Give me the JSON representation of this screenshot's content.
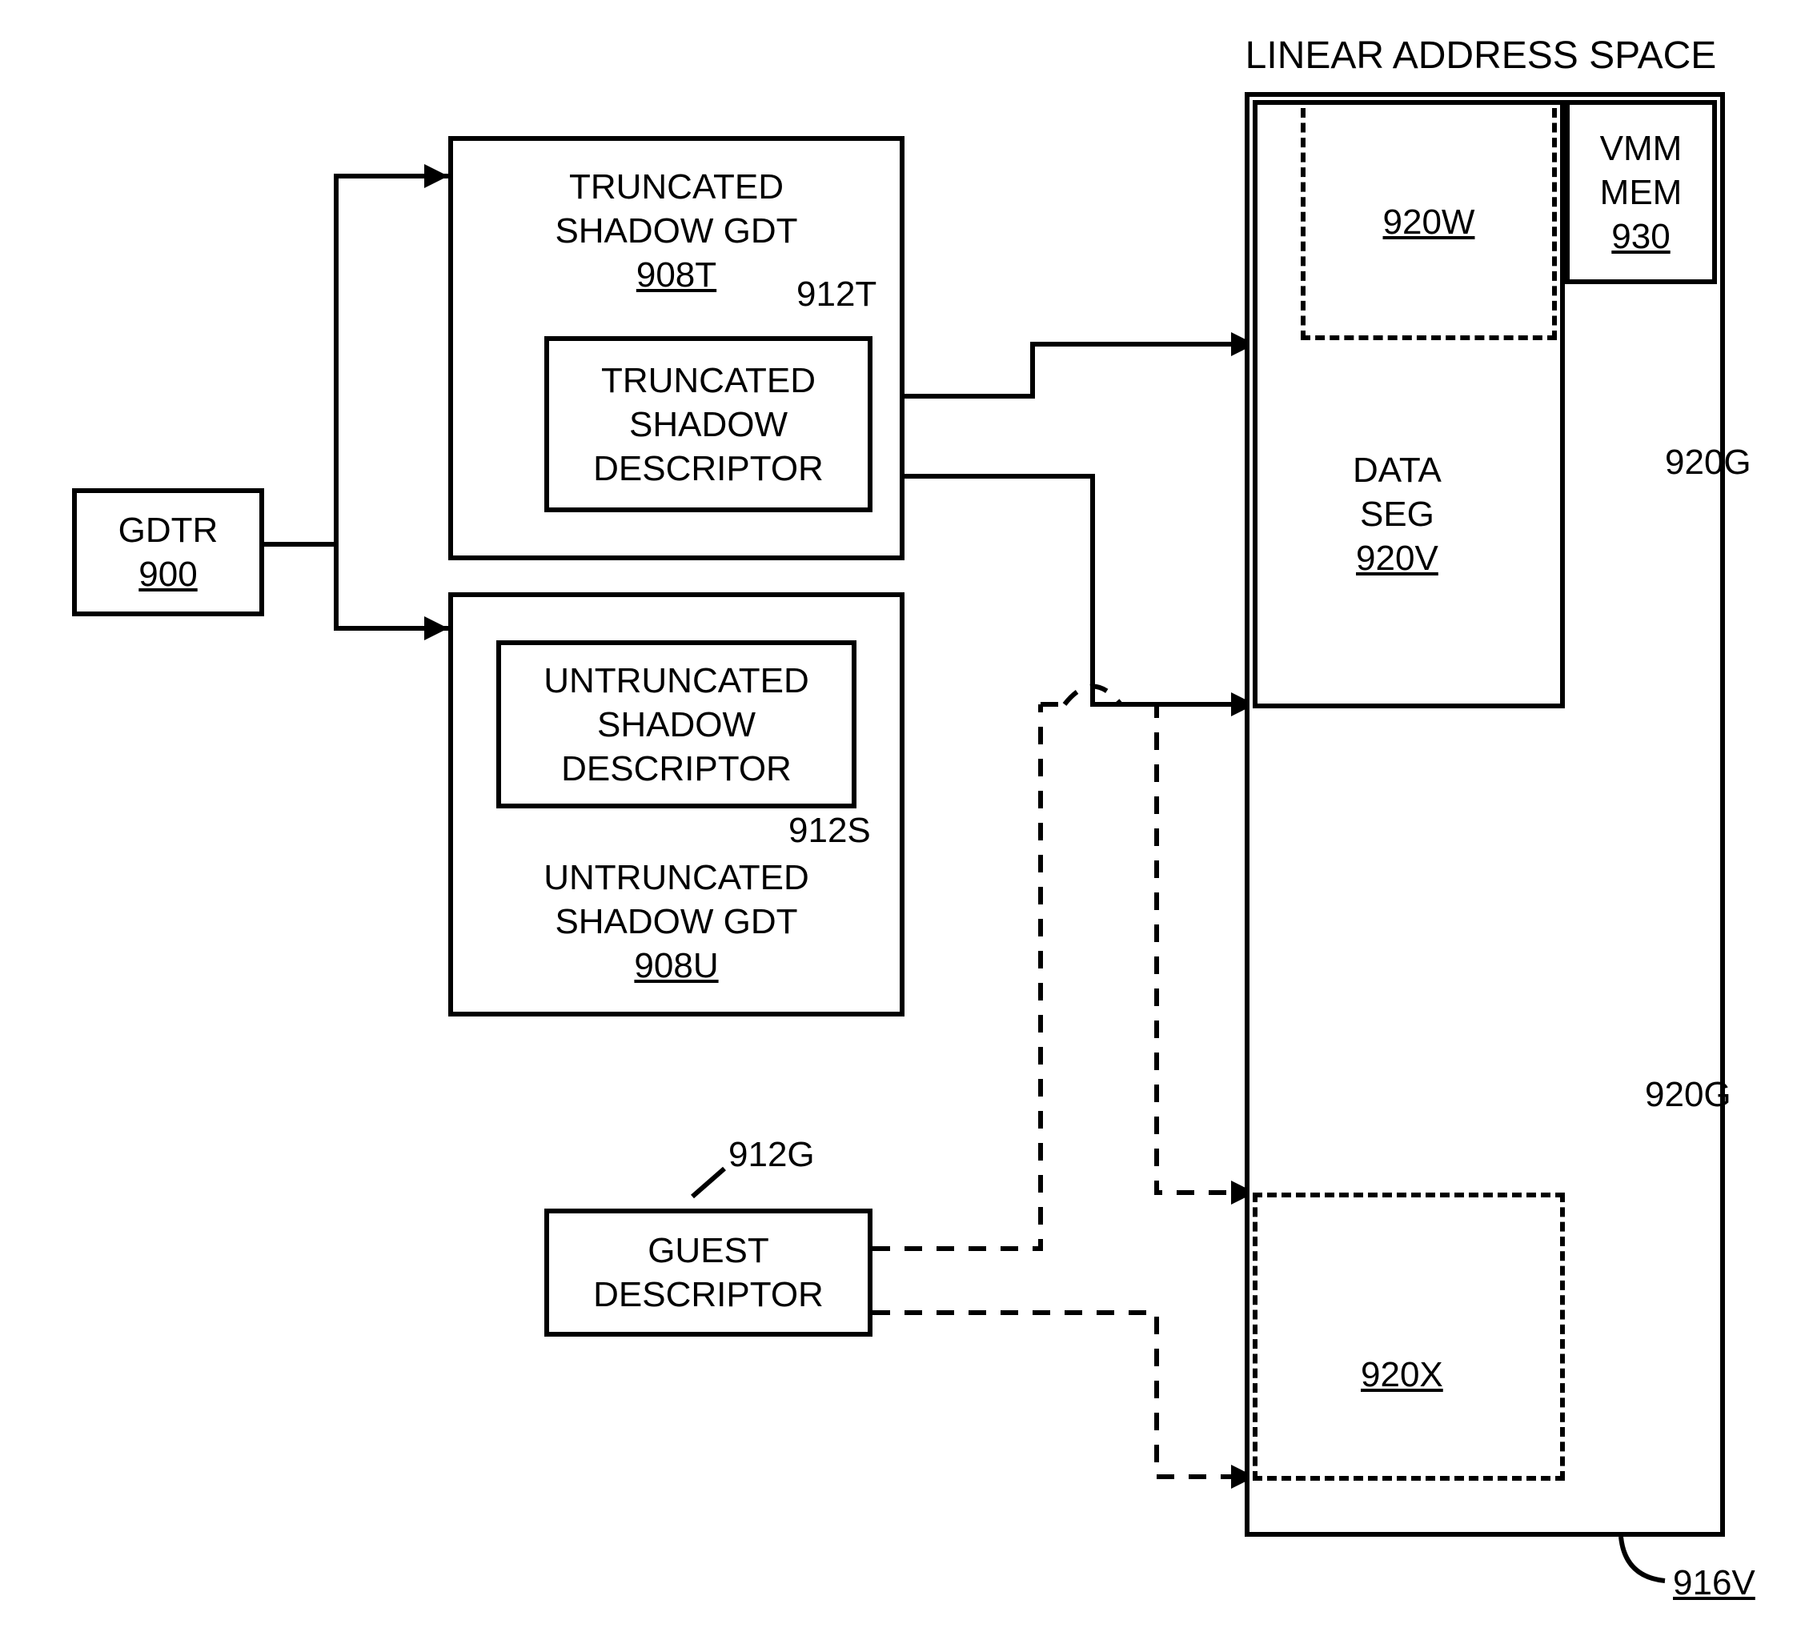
{
  "title": "LINEAR ADDRESS SPACE",
  "gdtr": {
    "label": "GDTR",
    "ref": "900"
  },
  "trunc_gdt": {
    "label1": "TRUNCATED",
    "label2": "SHADOW GDT",
    "ref": "908T"
  },
  "trunc_desc": {
    "label1": "TRUNCATED",
    "label2": "SHADOW",
    "label3": "DESCRIPTOR",
    "callout": "912T"
  },
  "untrunc_gdt": {
    "label1": "UNTRUNCATED",
    "label2": "SHADOW GDT",
    "ref": "908U"
  },
  "untrunc_desc": {
    "label1": "UNTRUNCATED",
    "label2": "SHADOW",
    "label3": "DESCRIPTOR",
    "callout": "912S"
  },
  "guest_desc": {
    "label1": "GUEST",
    "label2": "DESCRIPTOR",
    "callout": "912G"
  },
  "las": {
    "w": "920W",
    "v_label1": "DATA",
    "v_label2": "SEG",
    "v_ref": "920V",
    "x": "920X",
    "vmm_label1": "VMM",
    "vmm_label2": "MEM",
    "vmm_ref": "930",
    "g_upper": "920G",
    "g_lower": "920G",
    "outer_ref": "916V"
  }
}
